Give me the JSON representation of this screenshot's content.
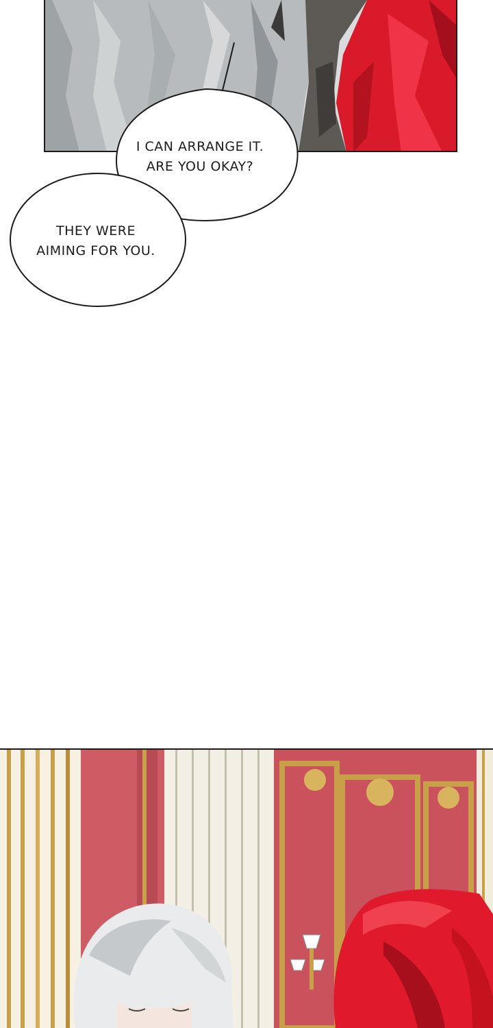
{
  "bubbles": [
    {
      "lines": [
        "I can arrange it.",
        "Are you okay?"
      ]
    },
    {
      "lines": [
        "They were",
        "aiming for you."
      ]
    }
  ],
  "colors": {
    "background": "#ffffff",
    "hair_silver": "#bfc3c5",
    "hair_red": "#e01a2c",
    "wall_red": "#cf5b64",
    "gold_trim": "#c9a04a",
    "border": "#1a1a1a"
  }
}
